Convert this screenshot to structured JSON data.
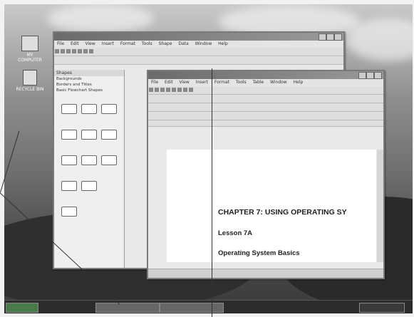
{
  "desktop": {
    "icons": [
      {
        "label": "MY COMPUTER"
      },
      {
        "label": "RECYCLE BIN"
      }
    ]
  },
  "back_window": {
    "menu": [
      "File",
      "Edit",
      "View",
      "Insert",
      "Format",
      "Tools",
      "Shape",
      "Data",
      "Window",
      "Help"
    ],
    "shapes_panel": {
      "title": "Shapes",
      "items": [
        "Backgrounds",
        "Borders and Titles",
        "Basic Flowchart Shapes"
      ]
    }
  },
  "front_window": {
    "menu": [
      "File",
      "Edit",
      "View",
      "Insert",
      "Format",
      "Tools",
      "Table",
      "Window",
      "Help"
    ]
  },
  "document": {
    "chapter": "CHAPTER 7: USING OPERATING SY",
    "lesson": "Lesson 7A",
    "heading": "Operating System Basics"
  }
}
